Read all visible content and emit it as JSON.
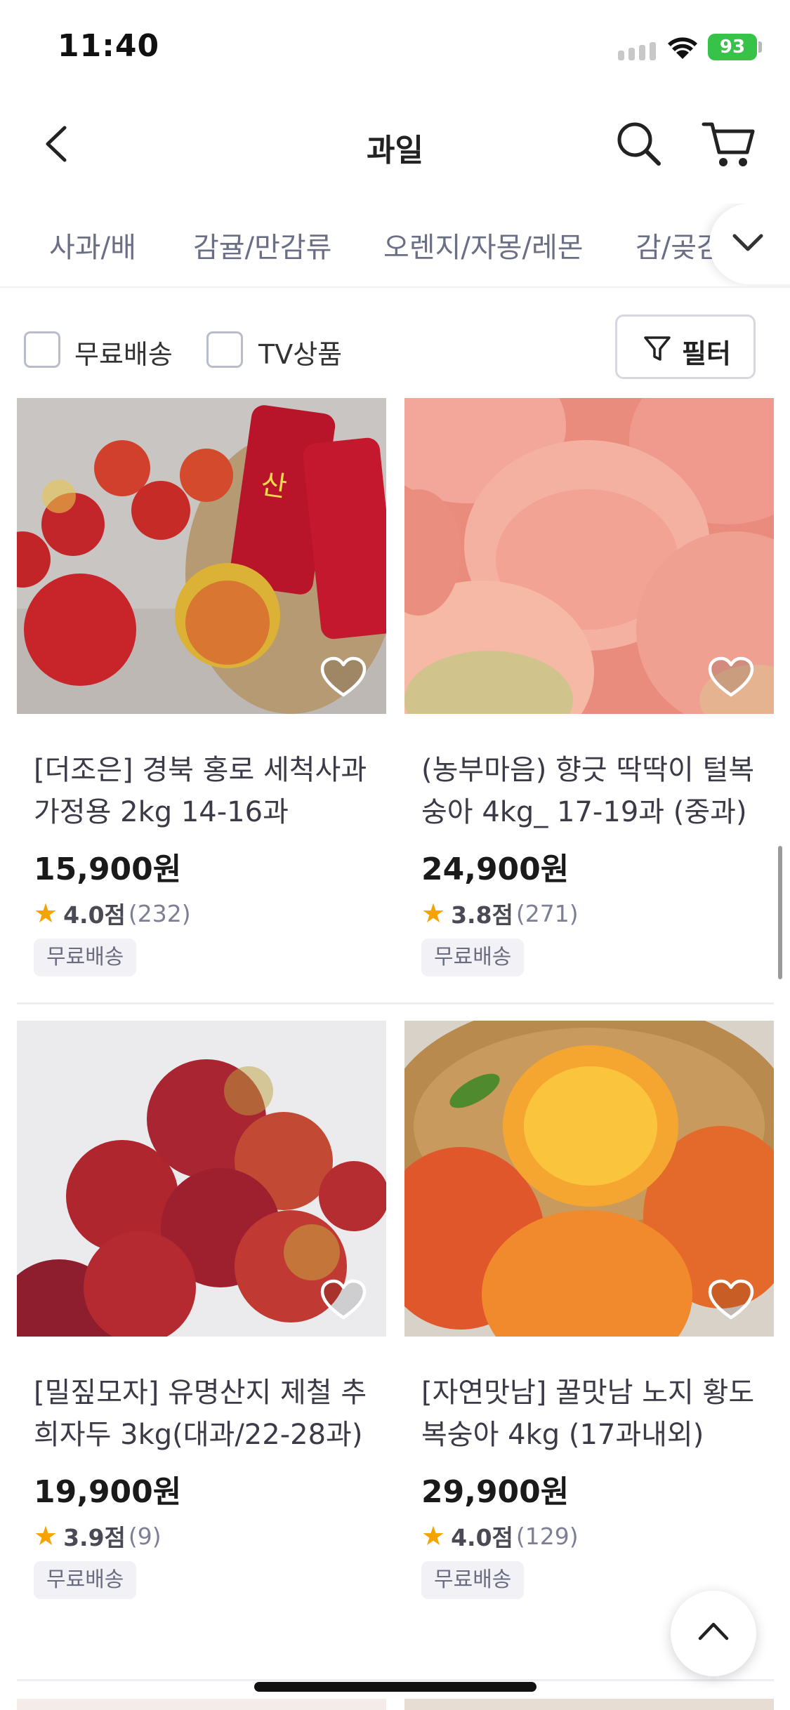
{
  "status_bar": {
    "time": "11:40",
    "battery": "93"
  },
  "header": {
    "title": "과일"
  },
  "categories": [
    "사과/배",
    "감귤/만감류",
    "오렌지/자몽/레몬",
    "감/곶감"
  ],
  "filters": {
    "free_shipping_label": "무료배송",
    "tv_label": "TV상품",
    "filter_label": "필터"
  },
  "products": [
    {
      "title": "[더조은] 경북 홍로 세척사과 가정용 2kg 14-16과",
      "price": "15,900원",
      "rating": "4.0점",
      "reviews": "(232)",
      "badge": "무료배송"
    },
    {
      "title": "(농부마음) 향긋 딱딱이 털복숭아  4kg_ 17-19과 (중과)",
      "price": "24,900원",
      "rating": "3.8점",
      "reviews": "(271)",
      "badge": "무료배송"
    },
    {
      "title": "[밀짚모자] 유명산지 제철 추희자두 3kg(대과/22-28과)",
      "price": "19,900원",
      "rating": "3.9점",
      "reviews": "(9)",
      "badge": "무료배송"
    },
    {
      "title": "[자연맛남] 꿀맛남 노지 황도복숭아 4kg (17과내외)",
      "price": "29,900원",
      "rating": "4.0점",
      "reviews": "(129)",
      "badge": "무료배송"
    }
  ],
  "colors": {
    "accent_star": "#f5a300",
    "battery": "#37c24a",
    "category_text": "#6b6f86"
  }
}
